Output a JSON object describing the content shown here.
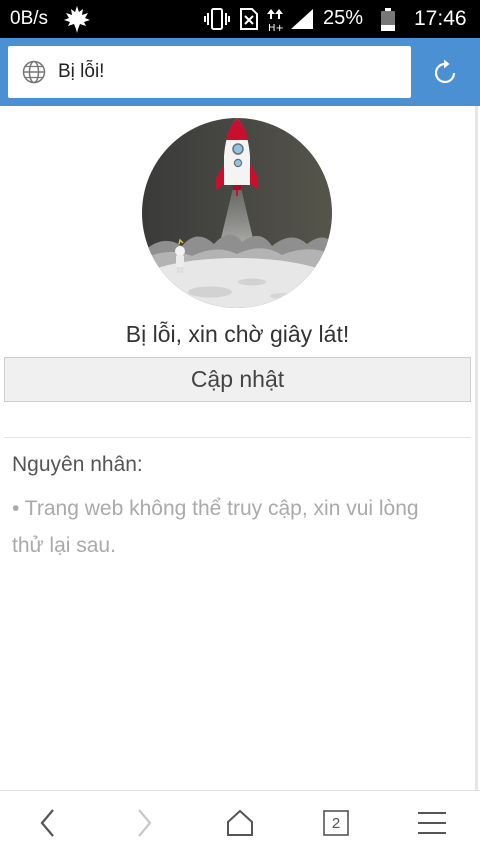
{
  "status_bar": {
    "network_speed": "0B/s",
    "battery_percent": "25%",
    "time": "17:46",
    "icons": [
      "maple-leaf-icon",
      "vibrate-icon",
      "no-sim-icon",
      "data-arrows-icon",
      "signal-icon",
      "battery-icon"
    ]
  },
  "address_bar": {
    "text": "Bị lỗi!",
    "icons": [
      "globe-icon",
      "reload-icon"
    ]
  },
  "error_page": {
    "title": "Bị lỗi, xin chờ giây lát!",
    "refresh_button": "Cập nhật",
    "reason_heading": "Nguyên nhân:",
    "reason_text": "• Trang web không thể truy cập, xin vui lòng thử lại sau.",
    "illustration": "rocket-launch-illustration"
  },
  "bottom_nav": {
    "tab_count": "2",
    "icons": [
      "back-icon",
      "forward-icon",
      "home-icon",
      "tabs-icon",
      "menu-icon"
    ]
  },
  "colors": {
    "accent": "#4a90d3",
    "status_bar": "#000000",
    "rocket_red": "#c8102e"
  }
}
